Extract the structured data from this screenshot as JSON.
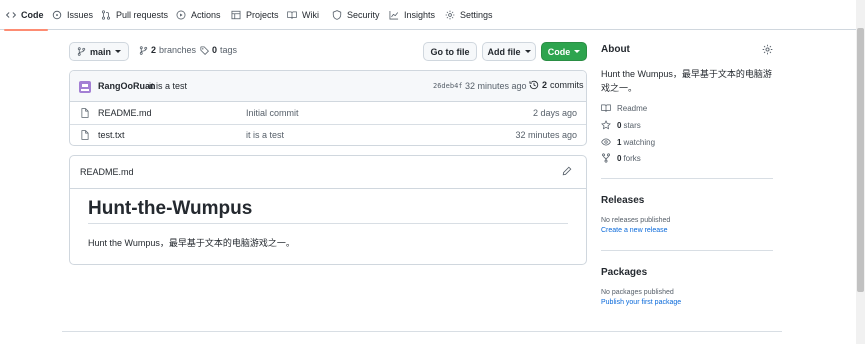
{
  "nav": {
    "tabs": [
      {
        "label": "Code",
        "icon": "code-icon"
      },
      {
        "label": "Issues",
        "icon": "issue-icon"
      },
      {
        "label": "Pull requests",
        "icon": "pull-request-icon"
      },
      {
        "label": "Actions",
        "icon": "play-icon"
      },
      {
        "label": "Projects",
        "icon": "table-icon"
      },
      {
        "label": "Wiki",
        "icon": "book-icon"
      },
      {
        "label": "Security",
        "icon": "shield-icon"
      },
      {
        "label": "Insights",
        "icon": "graph-icon"
      },
      {
        "label": "Settings",
        "icon": "gear-icon"
      }
    ],
    "active_accent": "#fd8c73"
  },
  "toolbar": {
    "branch": "main",
    "branches_count": "2",
    "branches_label": "branches",
    "tags_count": "0",
    "tags_label": "tags",
    "go_to_file": "Go to file",
    "add_file": "Add file",
    "code": "Code",
    "code_color": "#2da44e"
  },
  "commit": {
    "author": "RangOoRuan",
    "message": "it is a test",
    "sha": "26deb4f",
    "time": "32 minutes ago",
    "count": "2",
    "count_label": "commits"
  },
  "files": [
    {
      "name": "README.md",
      "message": "Initial commit",
      "age": "2 days ago"
    },
    {
      "name": "test.txt",
      "message": "it is a test",
      "age": "32 minutes ago"
    }
  ],
  "readme": {
    "label": "README.md",
    "title": "Hunt-the-Wumpus",
    "text": "Hunt the Wumpus，最早基于文本的电脑游戏之一。"
  },
  "about": {
    "title": "About",
    "description": "Hunt the Wumpus，最早基于文本的电脑游戏之一。",
    "readme_label": "Readme",
    "stars_count": "0",
    "stars_label": "stars",
    "watching_count": "1",
    "watching_label": "watching",
    "forks_count": "0",
    "forks_label": "forks"
  },
  "releases": {
    "title": "Releases",
    "empty": "No releases published",
    "link": "Create a new release"
  },
  "packages": {
    "title": "Packages",
    "empty": "No packages published",
    "link": "Publish your first package"
  }
}
